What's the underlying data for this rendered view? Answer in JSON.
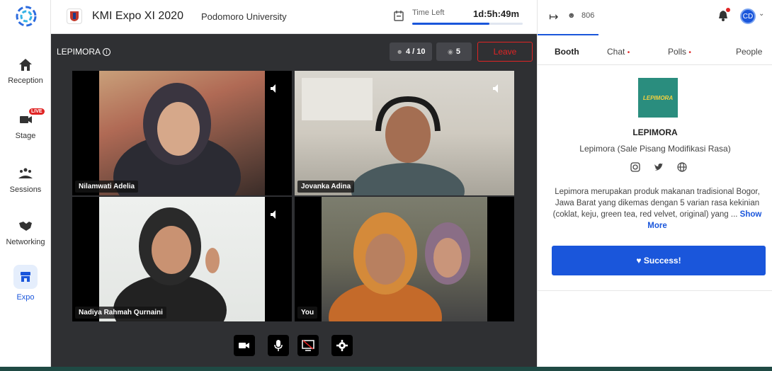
{
  "nav": {
    "items": [
      {
        "label": "Reception",
        "icon": "home-icon"
      },
      {
        "label": "Stage",
        "icon": "camera-live-icon",
        "badge": "LIVE"
      },
      {
        "label": "Sessions",
        "icon": "people-group-icon"
      },
      {
        "label": "Networking",
        "icon": "handshake-icon"
      },
      {
        "label": "Expo",
        "icon": "storefront-icon",
        "active": true
      }
    ]
  },
  "header": {
    "event_title": "KMI Expo XI 2020",
    "organizer": "Podomoro University",
    "time_left_label": "Time Left",
    "time_left_value": "1d:5h:49m",
    "time_left_progress": 0.7,
    "attendee_count": "806",
    "avatar_initials": "CD"
  },
  "stage": {
    "booth_name": "LEPIMORA",
    "participants": "4 / 10",
    "viewers": "5",
    "leave_label": "Leave",
    "tiles": [
      {
        "name": "Nilamwati Adelia"
      },
      {
        "name": "Jovanka Adina"
      },
      {
        "name": "Nadiya Rahmah Qurnaini"
      },
      {
        "name": "You"
      }
    ],
    "controls": [
      "camera-icon",
      "microphone-icon",
      "screen-share-off-icon",
      "settings-icon"
    ]
  },
  "panel": {
    "tabs": [
      {
        "label": "Booth",
        "active": true
      },
      {
        "label": "Chat",
        "dot": "•"
      },
      {
        "label": "Polls",
        "dot": "•"
      },
      {
        "label": "People"
      }
    ],
    "logo_text": "LEPIMORA",
    "brand_name": "LEPIMORA",
    "brand_subtitle": "Lepimora (Sale Pisang Modifikasi Rasa)",
    "socials": [
      "instagram-icon",
      "twitter-icon",
      "globe-icon"
    ],
    "description": "Lepimora merupakan produk makanan tradisional Bogor, Jawa Barat yang dikemas dengan 5 varian rasa kekinian (coklat, keju, green tea, red velvet, original) yang ...",
    "show_more": "Show More",
    "success_label": "Success!"
  },
  "colors": {
    "accent": "#1a56db",
    "danger": "#e02424",
    "stage_bg": "#2f3033"
  }
}
